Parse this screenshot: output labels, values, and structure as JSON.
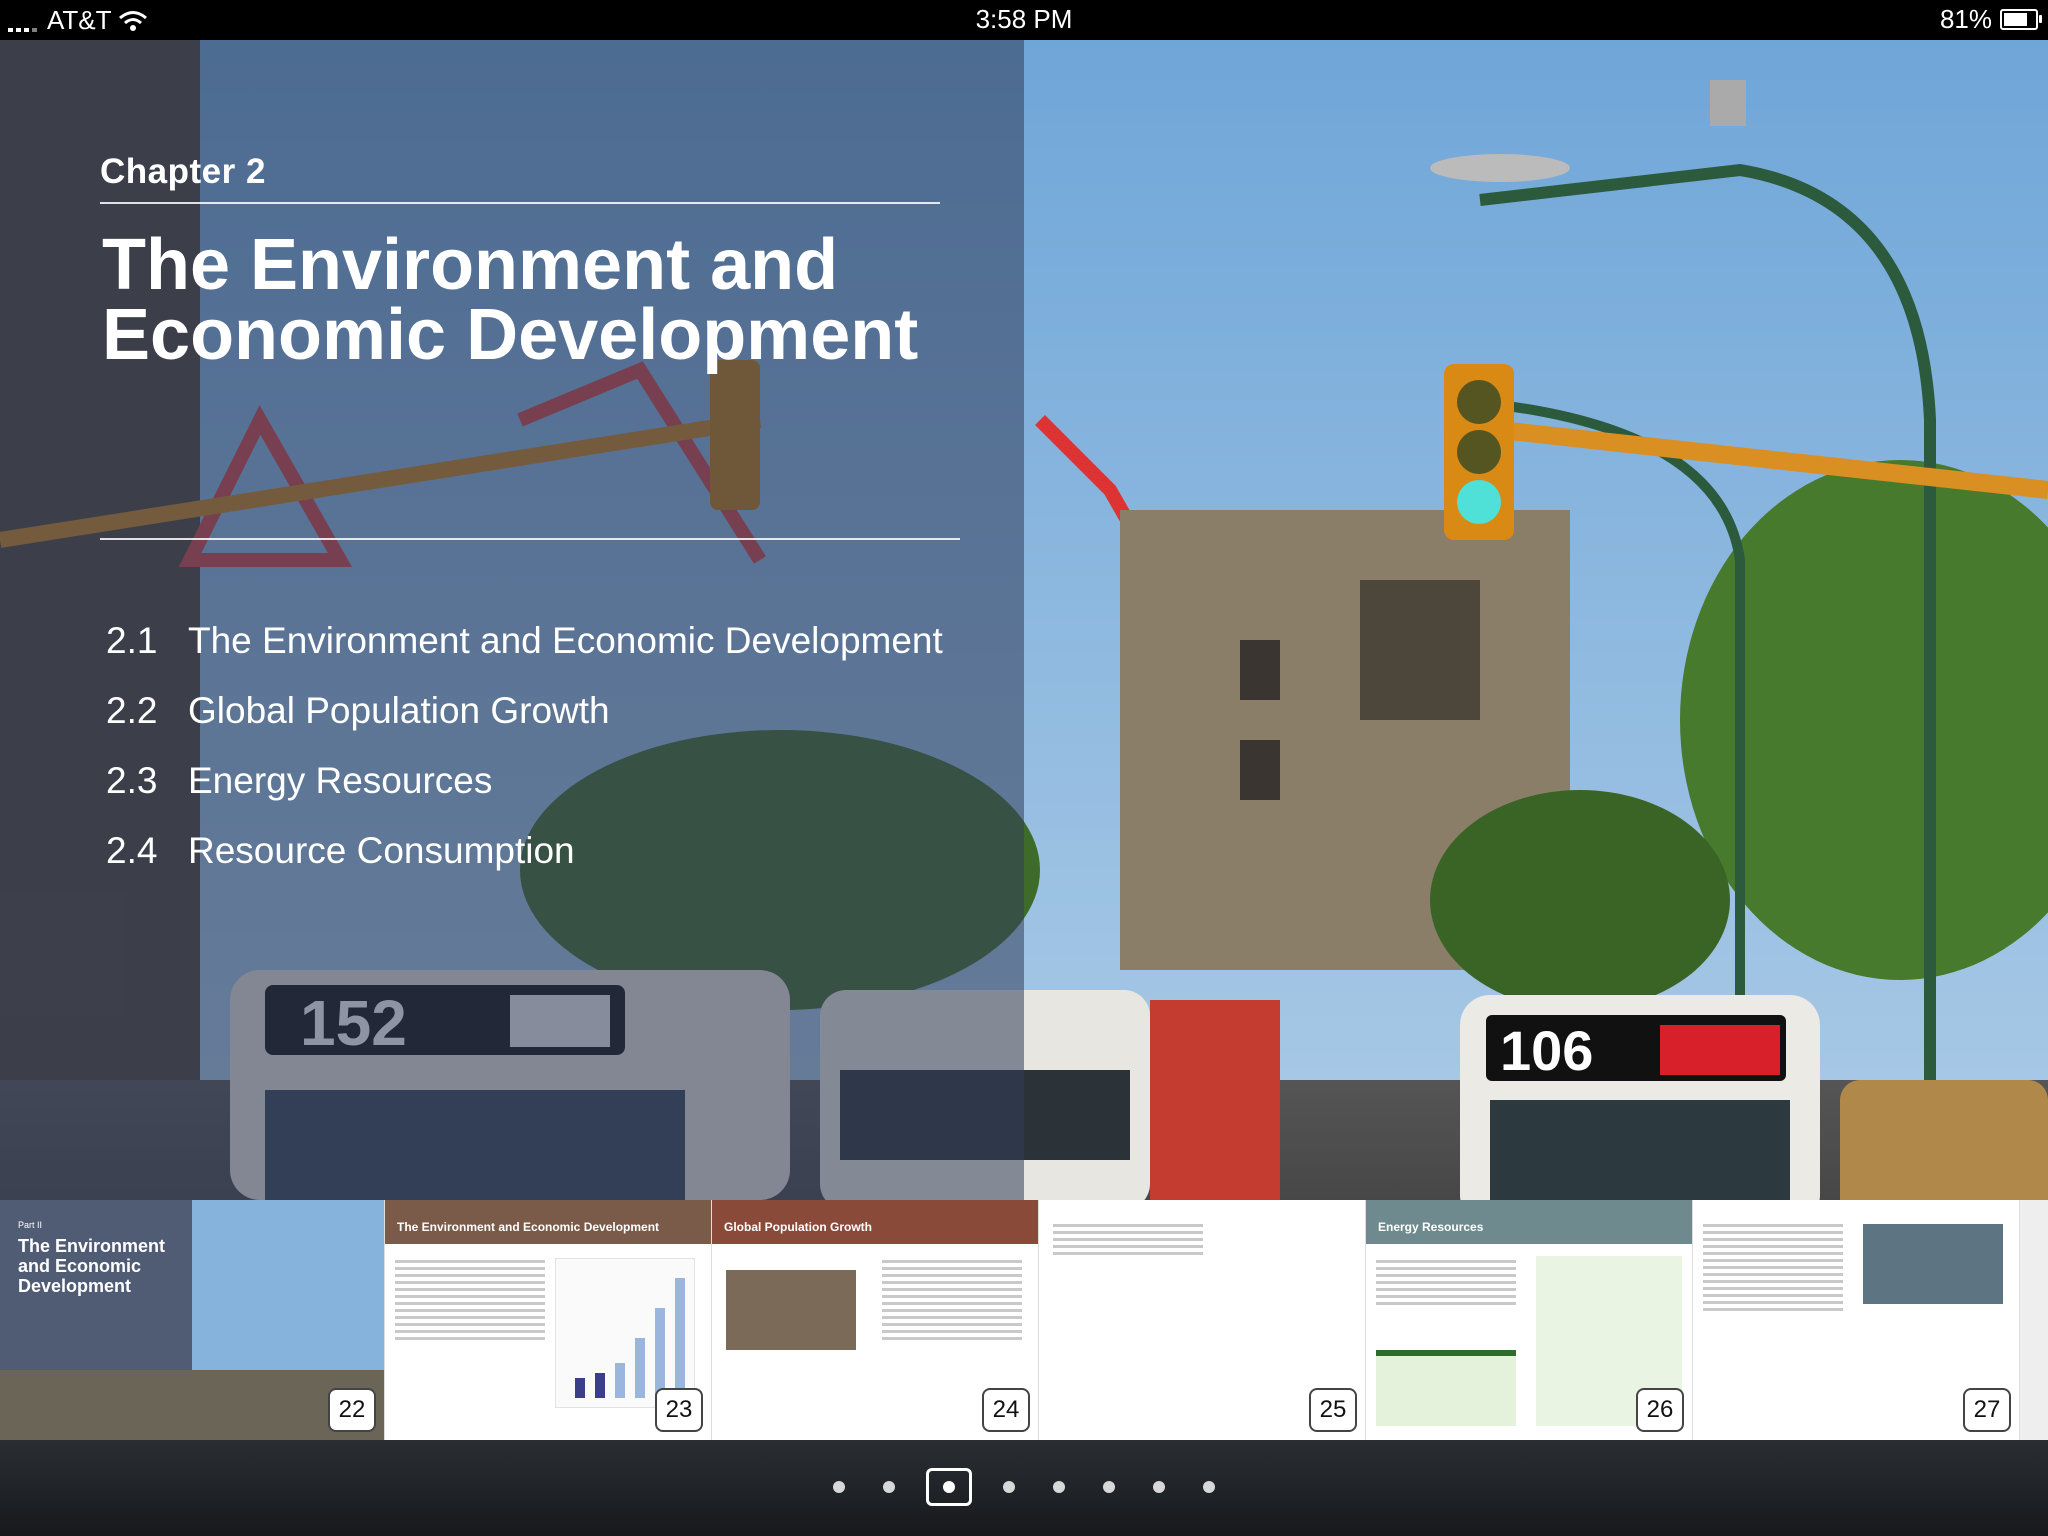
{
  "status_bar": {
    "carrier": "AT&T",
    "time": "3:58 PM",
    "battery": "81%",
    "battery_level": 0.81
  },
  "chapter": {
    "label": "Chapter 2",
    "title": "The Environment and Economic Development",
    "toc": [
      {
        "number": "2.1",
        "title": "The Environment and Economic Development"
      },
      {
        "number": "2.2",
        "title": "Global Population Growth"
      },
      {
        "number": "2.3",
        "title": "Energy Resources"
      },
      {
        "number": "2.4",
        "title": "Resource Consumption"
      }
    ]
  },
  "thumbnails": [
    {
      "page": "22",
      "heading": "The Environment and Economic Development",
      "kicker": "Part II"
    },
    {
      "page": "23",
      "heading": "The Environment and Economic Development"
    },
    {
      "page": "24",
      "heading": "Global Population Growth"
    },
    {
      "page": "25",
      "heading": ""
    },
    {
      "page": "26",
      "heading": "Energy Resources"
    },
    {
      "page": "27",
      "heading": ""
    }
  ],
  "pager": {
    "count": 8,
    "active_index": 2
  },
  "colors": {
    "overlay": "#323c5a",
    "sky": "#7fb0dc",
    "bottom_bar": "#1f2328"
  }
}
